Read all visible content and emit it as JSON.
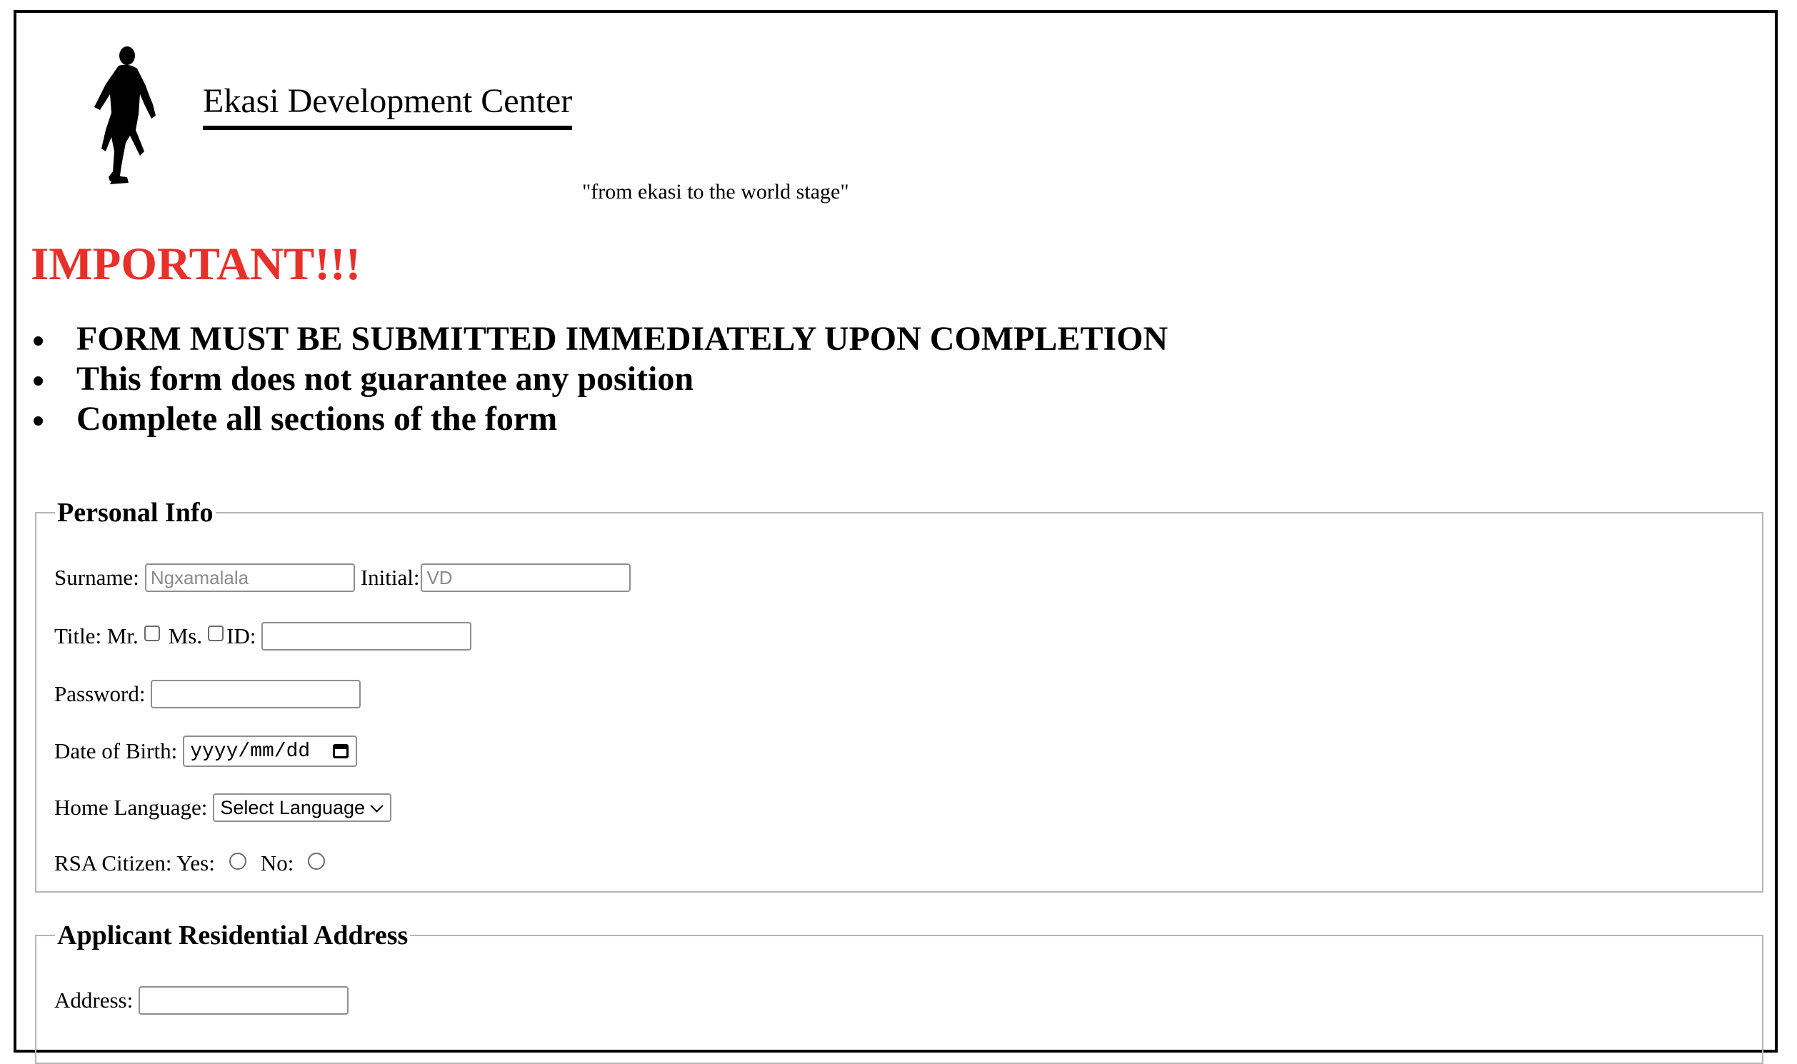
{
  "header": {
    "brand": "Ekasi Development Center",
    "slogan": "\"from ekasi to the world stage\"",
    "logo_icon": "runner-silhouette-icon"
  },
  "important": {
    "heading": "IMPORTANT!!!",
    "heading_color": "#e8302a",
    "notices": [
      "FORM MUST BE SUBMITTED IMMEDIATELY UPON COMPLETION",
      "This form does not guarantee any position",
      "Complete all sections of the form"
    ]
  },
  "personal_info": {
    "legend": "Personal Info",
    "surname_label": "Surname:",
    "surname_placeholder": "Ngxamalala",
    "initial_label": "Initial:",
    "initial_placeholder": "VD",
    "title_label": "Title: Mr.",
    "ms_label": "Ms.",
    "id_label": "ID:",
    "password_label": "Password:",
    "dob_label": "Date of Birth:",
    "dob_placeholder": "yyyy/mm/dd",
    "language_label": "Home Language:",
    "language_selected": "Select Language",
    "citizen_label": "RSA Citizen: Yes:",
    "no_label": "No:"
  },
  "residential_address": {
    "legend": "Applicant Residential Address",
    "address_label": "Address:"
  }
}
